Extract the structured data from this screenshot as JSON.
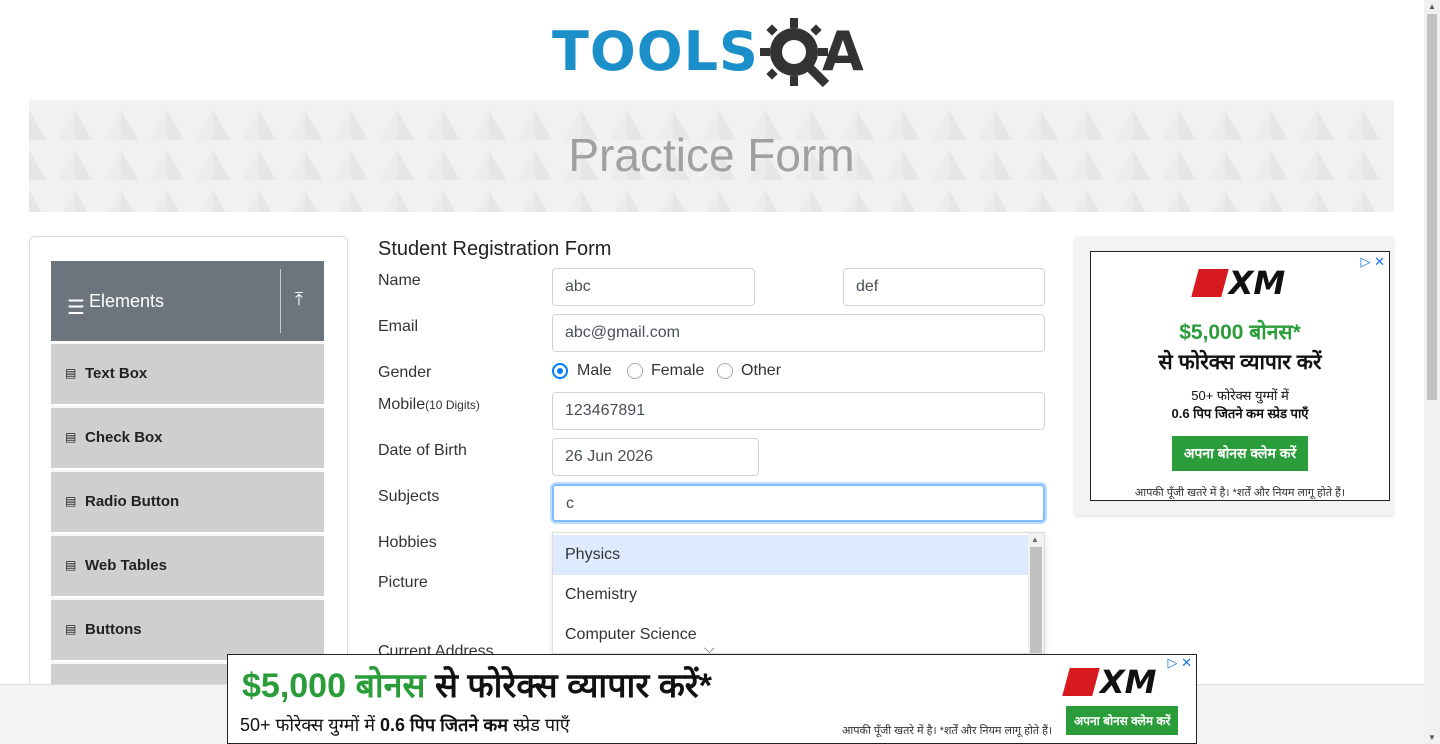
{
  "header": {
    "logo_text": "TOOLS",
    "logo_suffix": "A",
    "logo_name": "toolsqa-logo"
  },
  "banner": {
    "title": "Practice Form"
  },
  "sidebar": {
    "group_title": "Elements",
    "items": [
      {
        "label": "Text Box"
      },
      {
        "label": "Check Box"
      },
      {
        "label": "Radio Button"
      },
      {
        "label": "Web Tables"
      },
      {
        "label": "Buttons"
      }
    ]
  },
  "form": {
    "title": "Student Registration Form",
    "name_label": "Name",
    "first_name_value": "abc",
    "last_name_value": "def",
    "email_label": "Email",
    "email_value": "abc@gmail.com",
    "gender_label": "Gender",
    "gender_options": [
      "Male",
      "Female",
      "Other"
    ],
    "gender_selected": "Male",
    "mobile_label": "Mobile",
    "mobile_hint": "(10 Digits)",
    "mobile_value": "123467891",
    "dob_label": "Date of Birth",
    "dob_value": "26 Jun 2026",
    "subjects_label": "Subjects",
    "subjects_value": "c",
    "hobbies_label": "Hobbies",
    "picture_label": "Picture",
    "address_label": "Current Address"
  },
  "subjects_dropdown": {
    "options": [
      "Physics",
      "Chemistry",
      "Computer Science"
    ],
    "highlighted": "Physics"
  },
  "ad_right": {
    "brand": "XM",
    "headline_1": "$5,000 बोनस*",
    "headline_2": "से फोरेक्स व्यापार करें",
    "sub_1": "50+ फोरेक्स युग्मों में",
    "sub_2": "0.6 पिप जितने कम स्प्रेड पाएँ",
    "cta": "अपना बोनस क्लेम करें",
    "disclaimer": "आपकी पूँजी खतरे में है। *शर्तें और नियम लागू होते हैं।"
  },
  "ad_bottom": {
    "brand": "XM",
    "headline_green": "$5,000 बोनस",
    "headline_black": " से फोरेक्स व्यापार करें*",
    "sub_pre": "50+ फोरेक्स युग्मों में ",
    "sub_bold": "0.6 पिप जितने कम",
    "sub_post": " स्प्रेड पाएँ",
    "disclaimer": "आपकी पूँजी खतरे में है। *शर्तें और नियम लागू होते हैं।",
    "cta": "अपना बोनस क्लेम करें"
  },
  "colors": {
    "brand_blue": "#1b8fc9",
    "accent_blue": "#007bff",
    "ad_green": "#2a9d3a",
    "xm_red": "#d71920"
  }
}
